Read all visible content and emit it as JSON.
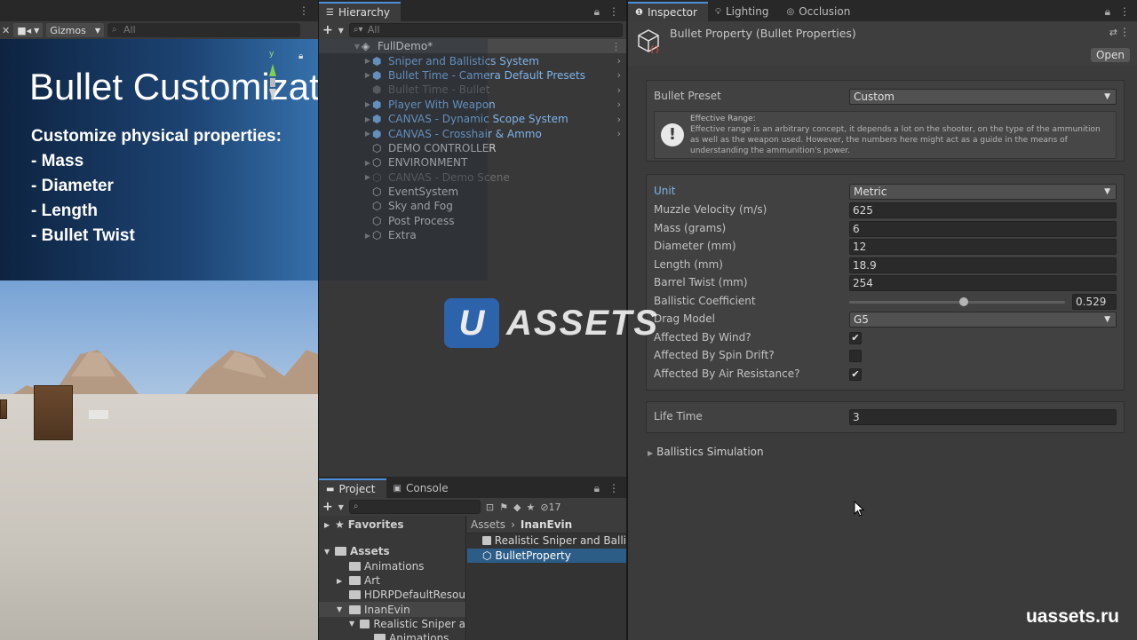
{
  "scene": {
    "toolbar": {
      "gizmos_label": "Gizmos",
      "search_placeholder": "All"
    },
    "banner": {
      "title": "Bullet Customization",
      "subtitle": "Customize physical properties:",
      "items": [
        "- Mass",
        "- Diameter",
        "- Length",
        "- Bullet Twist"
      ]
    },
    "gizmo_axis_label": "y"
  },
  "hierarchy": {
    "tab_label": "Hierarchy",
    "search_placeholder": "All",
    "scene_name": "FullDemo*",
    "items": [
      {
        "label": "Sniper and Ballistics System",
        "type": "prefab"
      },
      {
        "label": "Bullet Time - Camera Default Presets",
        "type": "prefab"
      },
      {
        "label": "Bullet Time - Bullet",
        "type": "disabled"
      },
      {
        "label": "Player With Weapon",
        "type": "prefab"
      },
      {
        "label": "CANVAS - Dynamic Scope System",
        "type": "prefab"
      },
      {
        "label": "CANVAS - Crosshair & Ammo",
        "type": "prefab"
      },
      {
        "label": "DEMO CONTROLLER",
        "type": "plain"
      },
      {
        "label": "ENVIRONMENT",
        "type": "plain"
      },
      {
        "label": "CANVAS - Demo Scene",
        "type": "disabled"
      },
      {
        "label": "EventSystem",
        "type": "plain"
      },
      {
        "label": "Sky and Fog",
        "type": "plain"
      },
      {
        "label": "Post Process",
        "type": "plain"
      },
      {
        "label": "Extra",
        "type": "plain"
      }
    ]
  },
  "project": {
    "tabs": {
      "project": "Project",
      "console": "Console"
    },
    "hidden_count": "17",
    "favorites_label": "Favorites",
    "tree": [
      "Assets",
      "Animations",
      "Art",
      "HDRPDefaultResou",
      "InanEvin",
      "Realistic Sniper a",
      "Animations"
    ],
    "breadcrumb": [
      "Assets",
      "InanEvin"
    ],
    "assets": [
      "Realistic Sniper and Balli",
      "BulletProperty"
    ]
  },
  "inspector": {
    "tabs": {
      "inspector": "Inspector",
      "lighting": "Lighting",
      "occlusion": "Occlusion"
    },
    "title": "Bullet Property (Bullet Properties)",
    "open_label": "Open",
    "preset": {
      "label": "Bullet Preset",
      "value": "Custom"
    },
    "help": {
      "title": "Effective Range:",
      "text": "Effective range is an arbitrary concept, it depends a lot on the shooter, on the type of the ammunition as well as the weapon used. However, the numbers here might act as a guide in the means of understanding the ammunition's power."
    },
    "unit": {
      "label": "Unit",
      "value": "Metric"
    },
    "muzzle_velocity": {
      "label": "Muzzle Velocity (m/s)",
      "value": "625"
    },
    "mass": {
      "label": "Mass (grams)",
      "value": "6"
    },
    "diameter": {
      "label": "Diameter (mm)",
      "value": "12"
    },
    "length": {
      "label": "Length (mm)",
      "value": "18.9"
    },
    "barrel_twist": {
      "label": "Barrel Twist (mm)",
      "value": "254"
    },
    "ballistic_coefficient": {
      "label": "Ballistic Coefficient",
      "value": "0.529",
      "slider_fraction": 0.529
    },
    "drag_model": {
      "label": "Drag Model",
      "value": "G5"
    },
    "wind": {
      "label": "Affected By Wind?",
      "checked": true
    },
    "spin_drift": {
      "label": "Affected By Spin Drift?",
      "checked": false
    },
    "air_resistance": {
      "label": "Affected By Air Resistance?",
      "checked": true
    },
    "life_time": {
      "label": "Life Time",
      "value": "3"
    },
    "ballistics_foldout": "Ballistics Simulation"
  },
  "watermark": {
    "logo_letter": "U",
    "logo_text": "ASSETS",
    "site": "uassets.ru"
  },
  "colors": {
    "accent": "#4c8ed8",
    "prefab_blue": "#7fb4ea",
    "selection": "#2c5d87"
  }
}
